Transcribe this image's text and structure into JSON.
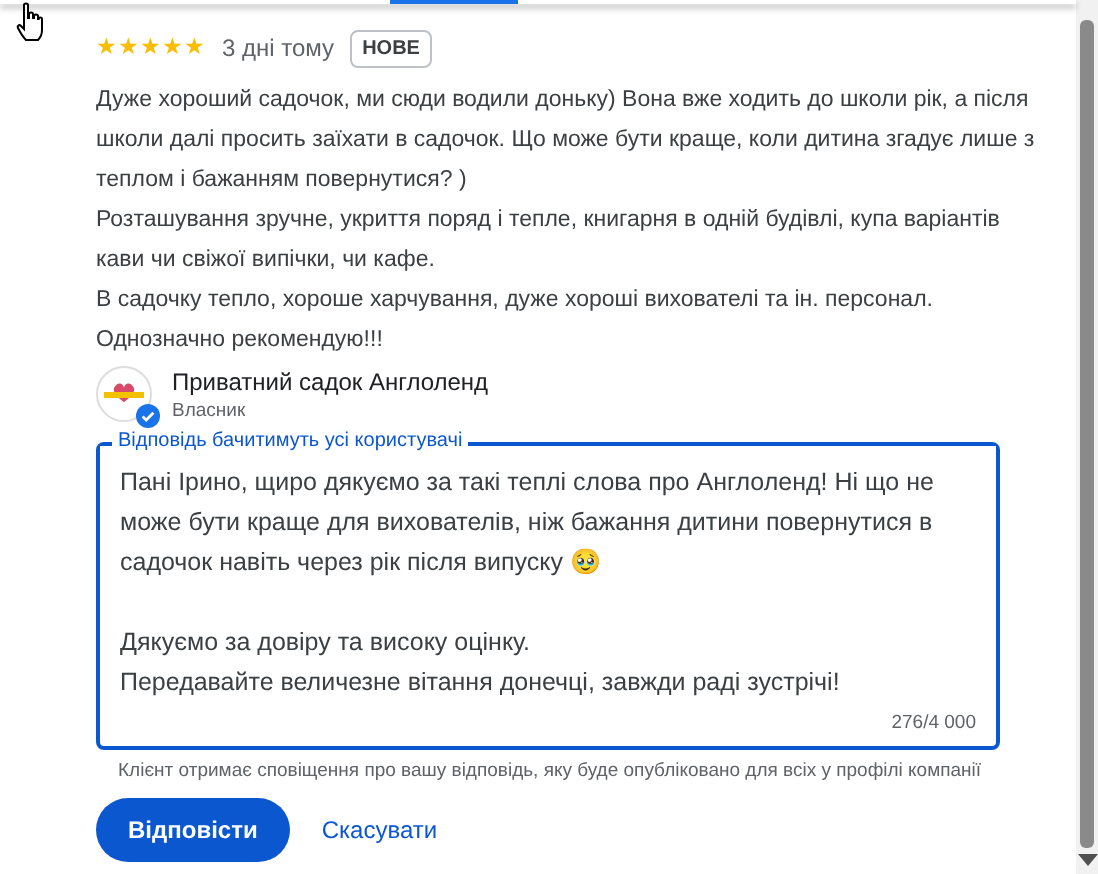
{
  "review": {
    "stars": 5,
    "time": "3 дні тому",
    "badge": "НОВЕ",
    "text": "Дуже хороший садочок, ми сюди водили доньку) Вона вже ходить до школи рік, а після школи далі просить заїхати в садочок. Що може бути краще, коли дитина згадує лише з теплом і бажанням повернутися? )\nРозташування зручне, укриття поряд і тепле, книгарня в одній будівлі, купа варіантів кави чи свіжої випічки, чи кафе.\nВ садочку тепло, хороше харчування, дуже хороші вихователі та ін. персонал.\nОднозначно рекомендую!!!"
  },
  "owner": {
    "name": "Приватний садок Англоленд",
    "role": "Власник",
    "verified": true
  },
  "reply": {
    "label": "Відповідь бачитимуть усі користувачі",
    "value": "Пані Ірино, щиро дякуємо за такі теплі слова про Англоленд! Ні що не може бути краще для вихователів, ніж бажання дитини повернутися в садочок навіть через рік після випуску 🥹\n\nДякуємо за довіру та високу оцінку.\nПередавайте величезне вітання донечці, завжди раді зустрічі!",
    "counter": "276/4 000",
    "hint": "Клієнт отримає сповіщення про вашу відповідь, яку буде опубліковано для всіх у профілі компанії"
  },
  "buttons": [
    {
      "kind": "primary",
      "label": "Відповісти"
    },
    {
      "kind": "text",
      "label": "Скасувати"
    }
  ]
}
